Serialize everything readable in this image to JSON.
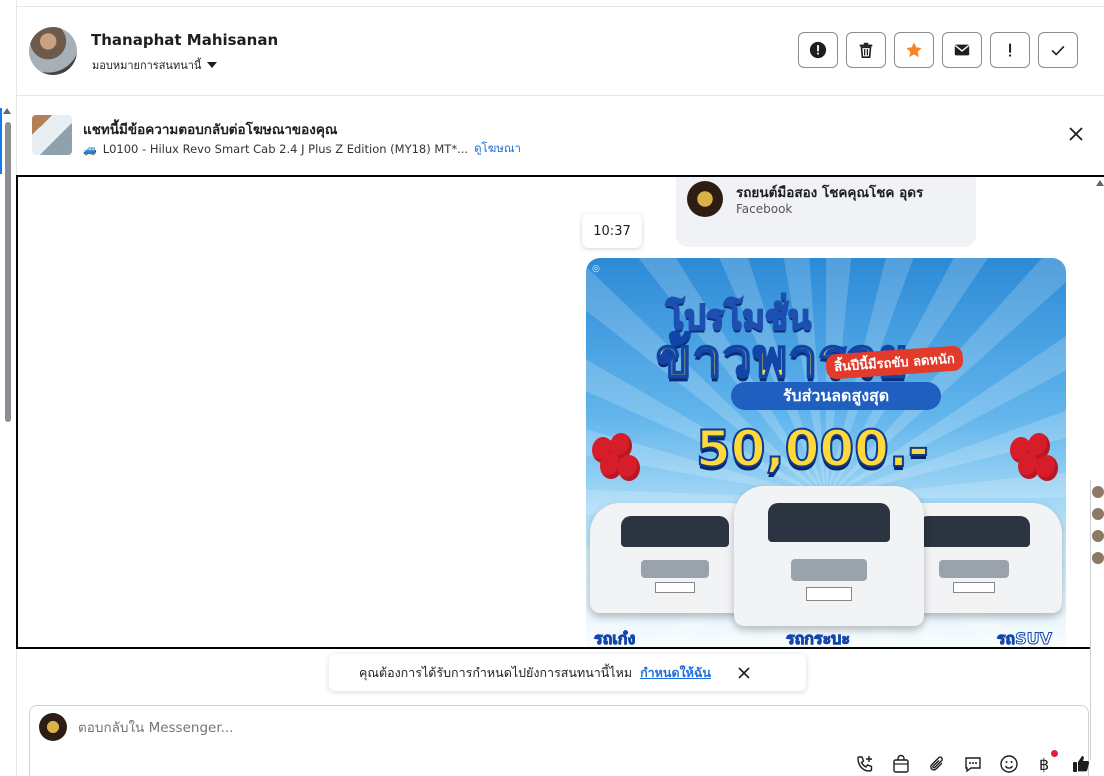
{
  "header": {
    "contact_name": "Thanaphat Mahisanan",
    "assign_label": "มอบหมายการสนทนานี้",
    "actions": [
      {
        "name": "spam-button",
        "icon": "alert-circle-icon"
      },
      {
        "name": "delete-button",
        "icon": "trash-icon"
      },
      {
        "name": "star-button",
        "icon": "star-icon"
      },
      {
        "name": "mark-unread-button",
        "icon": "envelope-icon"
      },
      {
        "name": "follow-up-button",
        "icon": "exclamation-icon"
      },
      {
        "name": "mark-done-button",
        "icon": "check-icon"
      }
    ]
  },
  "ad_reply": {
    "title": "แชทนี้มีข้อความตอบกลับต่อโฆษณาของคุณ",
    "ad_text": "L0100 - Hilux Revo Smart Cab 2.4 J Plus Z Edition (MY18) MT*...",
    "view_ad_link": "ดูโฆษณา"
  },
  "conversation": {
    "sender_name": "รถยนต์มือสอง โชคคุณโชค อุดร",
    "sender_source": "Facebook",
    "timestamp": "10:37",
    "promo": {
      "line1": "โปรโมชั่น",
      "line2": "ข้าวพารวย",
      "tagline": "สิ้นปีนี้มีรถขับ ลดหนัก",
      "discount_label": "รับส่วนลดสูงสุด",
      "amount": "50,000.-",
      "left_label": "รถเก๋ง",
      "center_label": "รถกระบะ",
      "right_label": "รถSUV"
    }
  },
  "suggestion": {
    "text": "คุณต้องการได้รับการกำหนดไปยังการสนทนานี้ไหม",
    "action": "กำหนดให้ฉัน"
  },
  "composer": {
    "placeholder": "ตอบกลับใน Messenger...",
    "tools": [
      "call-add-icon",
      "shopping-bag-icon",
      "paperclip-icon",
      "chat-bubble-icon",
      "emoji-icon",
      "baht-icon",
      "thumbs-up-icon"
    ]
  },
  "colors": {
    "accent": "#216fdb",
    "star": "#f5842b",
    "like": "#1c1e21"
  }
}
